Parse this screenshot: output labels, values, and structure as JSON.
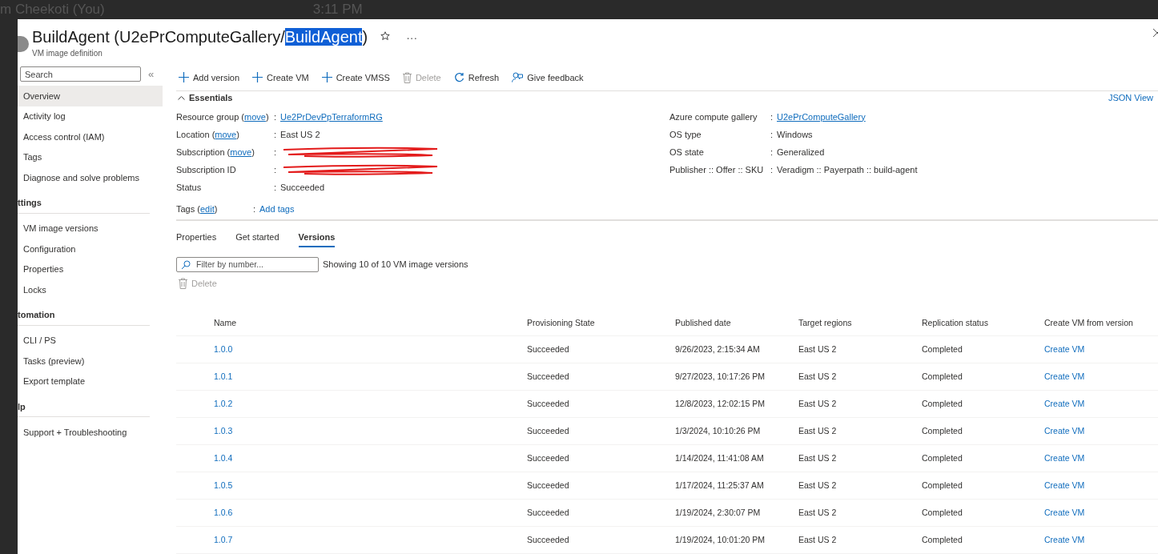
{
  "backdrop": {
    "caller": "m Cheekoti (You)",
    "time": "3:11 PM"
  },
  "header": {
    "title": {
      "before": "BuildAgent (U2ePrComputeGallery/",
      "selection": "BuildAgent",
      "after": ")"
    },
    "subtitle": "VM image definition",
    "more": "···"
  },
  "sidebar": {
    "search": {
      "placeholder": "Search"
    },
    "collapse": "«",
    "items": [
      {
        "kind": "item",
        "label": "Overview",
        "selected": true
      },
      {
        "kind": "item",
        "label": "Activity log",
        "selected": false
      },
      {
        "kind": "item",
        "label": "Access control (IAM)",
        "selected": false
      },
      {
        "kind": "item",
        "label": "Tags",
        "selected": false
      },
      {
        "kind": "item",
        "label": "Diagnose and solve problems",
        "selected": false
      },
      {
        "kind": "section",
        "label": "ttings"
      },
      {
        "kind": "item",
        "label": "VM image versions",
        "selected": false
      },
      {
        "kind": "item",
        "label": "Configuration",
        "selected": false
      },
      {
        "kind": "item",
        "label": "Properties",
        "selected": false
      },
      {
        "kind": "item",
        "label": "Locks",
        "selected": false
      },
      {
        "kind": "section",
        "label": "tomation"
      },
      {
        "kind": "item",
        "label": "CLI / PS",
        "selected": false
      },
      {
        "kind": "item",
        "label": "Tasks (preview)",
        "selected": false
      },
      {
        "kind": "item",
        "label": "Export template",
        "selected": false
      },
      {
        "kind": "section",
        "label": "lp"
      },
      {
        "kind": "item",
        "label": "Support + Troubleshooting",
        "selected": false
      }
    ]
  },
  "toolbar": [
    {
      "kind": "add",
      "label": "Add version",
      "disabled": false
    },
    {
      "kind": "add",
      "label": "Create VM",
      "disabled": false
    },
    {
      "kind": "add",
      "label": "Create VMSS",
      "disabled": false
    },
    {
      "kind": "delete",
      "label": "Delete",
      "disabled": true
    },
    {
      "kind": "refresh",
      "label": "Refresh",
      "disabled": false
    },
    {
      "kind": "feedback",
      "label": "Give feedback",
      "disabled": false
    }
  ],
  "essentials": {
    "title": "Essentials",
    "expanded": true,
    "json_view": "JSON View",
    "left": [
      {
        "label": "Resource group (",
        "link": "move",
        "label_end": ")",
        "colon": ":",
        "value": "Ue2PrDevPpTerraformRG",
        "value_is_link": true,
        "redacted": false
      },
      {
        "label": "Location (",
        "link": "move",
        "label_end": ")",
        "colon": ":",
        "value": "East US 2",
        "value_is_link": false,
        "redacted": false
      },
      {
        "label": "Subscription (",
        "link": "move",
        "label_end": ")",
        "colon": ":",
        "redacted": true
      },
      {
        "label": "Subscription ID",
        "colon": ":",
        "redacted": true
      },
      {
        "label": "Status",
        "colon": ":",
        "value": "Succeeded",
        "value_is_link": false,
        "redacted": false
      }
    ],
    "right": [
      {
        "label": "Azure compute gallery",
        "colon": ":",
        "value": "U2ePrComputeGallery",
        "value_is_link": true
      },
      {
        "label": "OS type",
        "colon": ":",
        "value": "Windows",
        "value_is_link": false
      },
      {
        "label": "OS state",
        "colon": ":",
        "value": "Generalized",
        "value_is_link": false
      },
      {
        "label": "Publisher :: Offer :: SKU",
        "colon": ":",
        "value": "Veradigm :: Payerpath :: build-agent",
        "value_is_link": false
      }
    ],
    "tags": {
      "label": "Tags (",
      "link": "edit",
      "label_end": ")",
      "colon": ":",
      "value": "Add tags"
    }
  },
  "tabs": [
    {
      "label": "Properties",
      "selected": false
    },
    {
      "label": "Get started",
      "selected": false
    },
    {
      "label": "Versions",
      "selected": true
    }
  ],
  "filter": {
    "placeholder": "Filter by number...",
    "count": "Showing 10 of 10 VM image versions"
  },
  "delete_action": {
    "label": "Delete",
    "disabled": true
  },
  "table": {
    "columns": [
      "Name",
      "Provisioning State",
      "Published date",
      "Target regions",
      "Replication status",
      "Create VM from version"
    ],
    "rows": [
      [
        "1.0.0",
        "Succeeded",
        "9/26/2023, 2:15:34 AM",
        "East US 2",
        "Completed",
        "Create VM"
      ],
      [
        "1.0.1",
        "Succeeded",
        "9/27/2023, 10:17:26 PM",
        "East US 2",
        "Completed",
        "Create VM"
      ],
      [
        "1.0.2",
        "Succeeded",
        "12/8/2023, 12:02:15 PM",
        "East US 2",
        "Completed",
        "Create VM"
      ],
      [
        "1.0.3",
        "Succeeded",
        "1/3/2024, 10:10:26 PM",
        "East US 2",
        "Completed",
        "Create VM"
      ],
      [
        "1.0.4",
        "Succeeded",
        "1/14/2024, 11:41:08 AM",
        "East US 2",
        "Completed",
        "Create VM"
      ],
      [
        "1.0.5",
        "Succeeded",
        "1/17/2024, 11:25:37 AM",
        "East US 2",
        "Completed",
        "Create VM"
      ],
      [
        "1.0.6",
        "Succeeded",
        "1/19/2024, 2:30:07 PM",
        "East US 2",
        "Completed",
        "Create VM"
      ],
      [
        "1.0.7",
        "Succeeded",
        "1/19/2024, 10:01:20 PM",
        "East US 2",
        "Completed",
        "Create VM"
      ]
    ]
  }
}
